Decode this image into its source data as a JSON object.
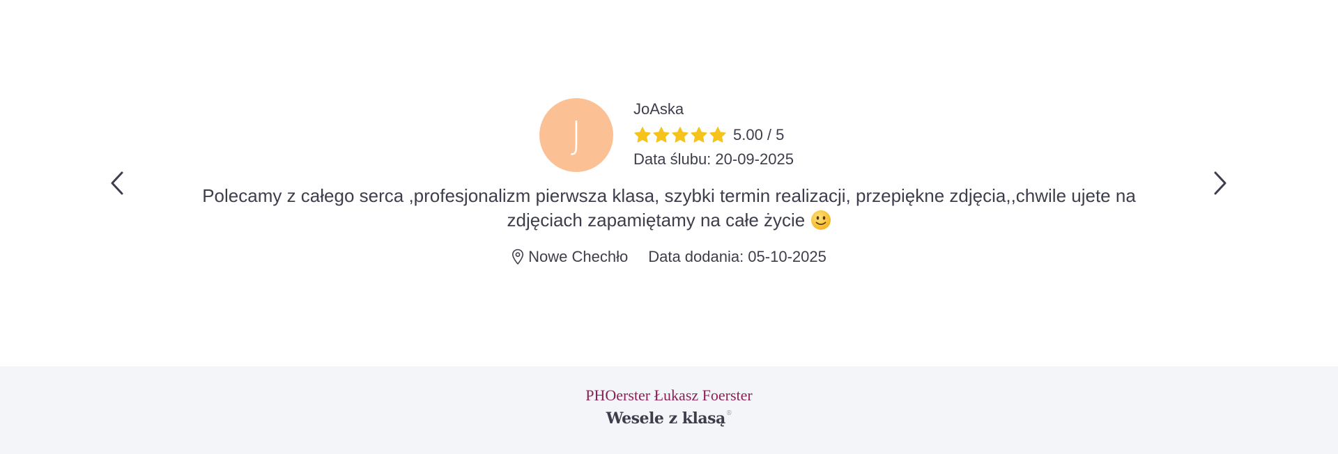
{
  "review": {
    "avatar_letter": "J",
    "avatar_color": "#fbc195",
    "author": "JoAska",
    "rating_value": 5.0,
    "rating_text": "5.00 / 5",
    "star_color": "#f6c21c",
    "wedding_date": "Data ślubu: 20-09-2025",
    "text": "Polecamy z całego serca ,profesjonalizm pierwsza klasa, szybki termin realizacji, przepiękne zdjęcia,,chwile ujete na zdjęciach zapamiętamy na całe życie",
    "text_emoji": "slightly-smiling-face-emoji",
    "location": "Nowe Chechło",
    "added_date": "Data dodania: 05-10-2025"
  },
  "nav": {
    "prev_icon": "chevron-left-icon",
    "next_icon": "chevron-right-icon"
  },
  "footer": {
    "company": "PHOerster Łukasz Foerster",
    "brand": "Wesele z klasą",
    "brand_mark": "®",
    "background": "#f4f5f9",
    "company_color": "#8a2156"
  }
}
